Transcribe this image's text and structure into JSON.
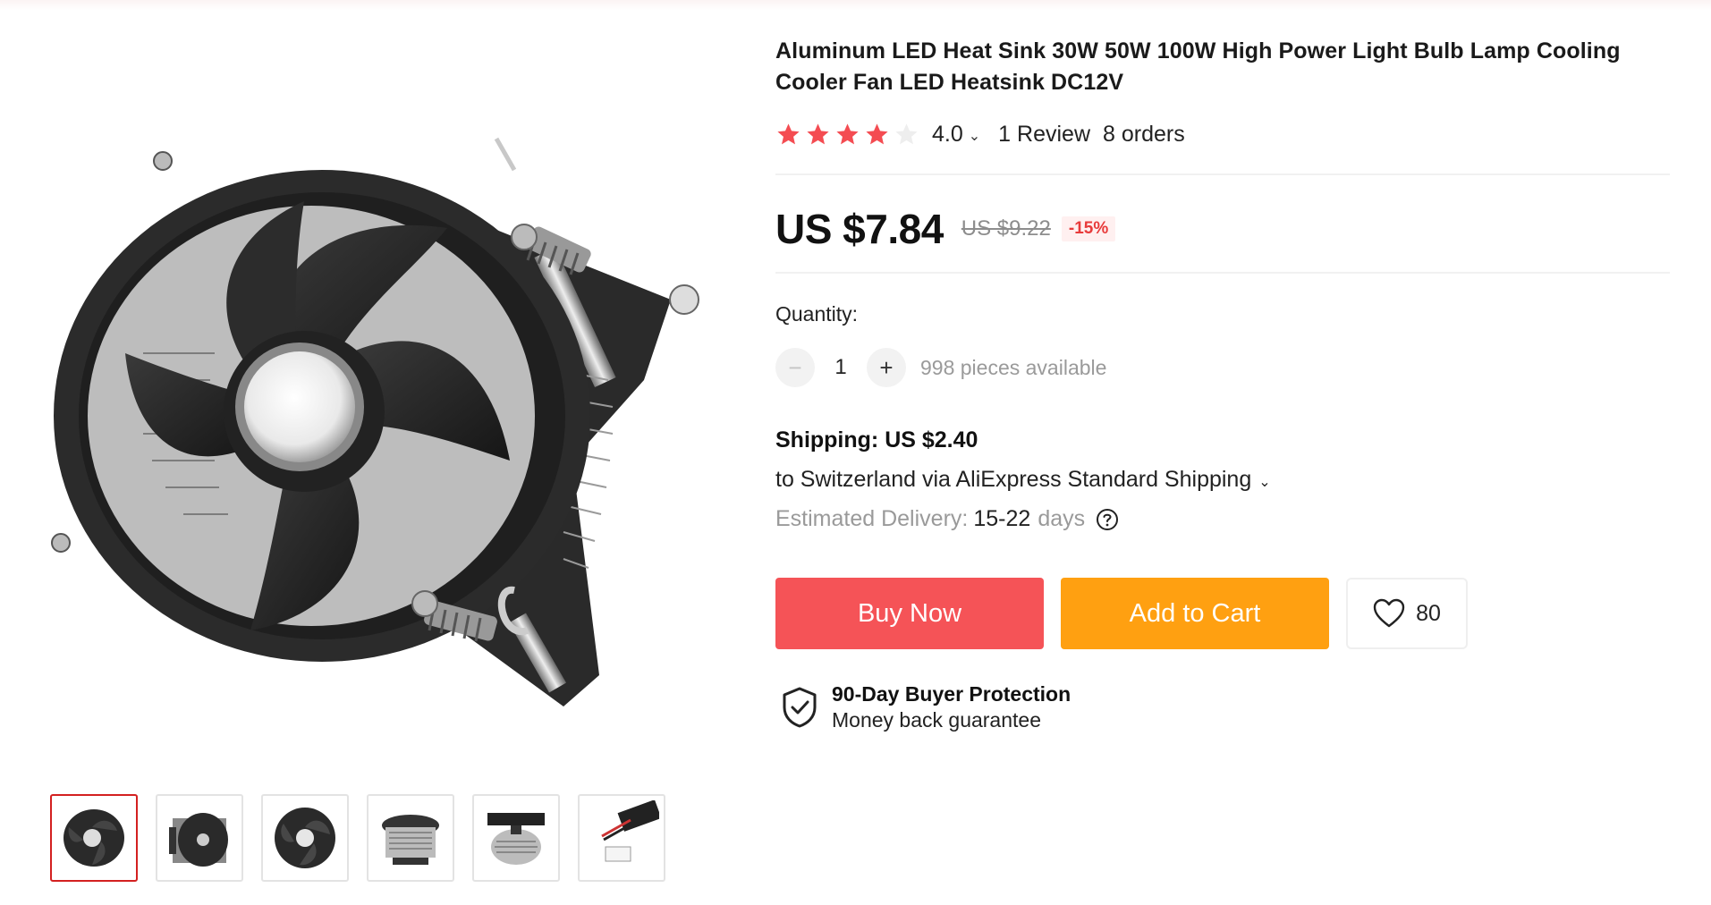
{
  "product": {
    "title": "Aluminum LED Heat Sink 30W 50W 100W High Power Light Bulb Lamp Cooling Cooler Fan LED Heatsink DC12V",
    "rating": {
      "stars": 4.0,
      "value_label": "4.0",
      "reviews_label": "1 Review",
      "orders_label": "8 orders"
    },
    "price": {
      "current": "US $7.84",
      "original": "US $9.22",
      "discount": "-15%"
    }
  },
  "quantity": {
    "label": "Quantity:",
    "value": "1",
    "decrement_symbol": "−",
    "increment_symbol": "+",
    "available": "998 pieces available"
  },
  "shipping": {
    "title": "Shipping: US $2.40",
    "destination": "to Switzerland via AliExpress Standard Shipping",
    "delivery_label": "Estimated Delivery:",
    "delivery_range": "15-22",
    "delivery_unit": "days"
  },
  "actions": {
    "buy_now": "Buy Now",
    "add_to_cart": "Add to Cart",
    "wishlist_count": "80"
  },
  "protection": {
    "title": "90-Day Buyer Protection",
    "subtitle": "Money back guarantee"
  },
  "colors": {
    "buy_now": "#f55357",
    "add_to_cart": "#ffa011",
    "star": "#f44c52",
    "thumb_active_border": "#d32020",
    "discount_text": "#e83b3b"
  },
  "gallery": {
    "thumbnails": [
      "fan-angled-view",
      "fan-side-view",
      "fan-top-view",
      "heatsink-clear-view",
      "heatsink-frame-view",
      "power-cable-view"
    ],
    "selected_index": 0
  }
}
